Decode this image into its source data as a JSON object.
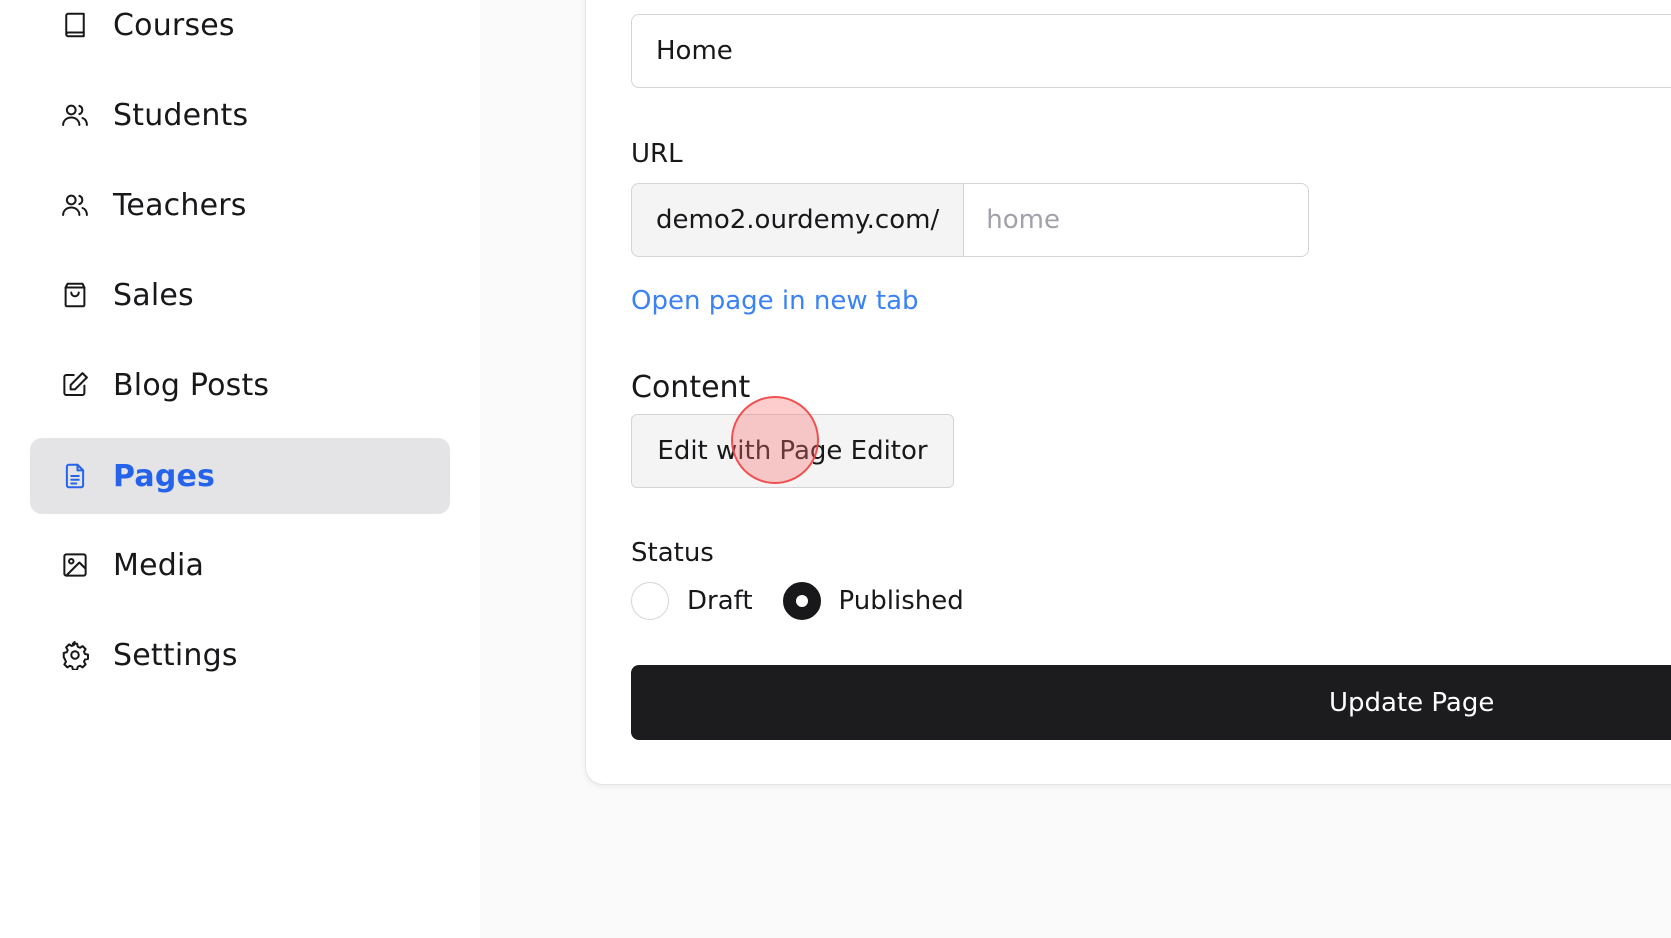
{
  "sidebar": {
    "items": [
      {
        "label": "Courses",
        "icon": "book-icon",
        "active": false
      },
      {
        "label": "Students",
        "icon": "users-icon",
        "active": false
      },
      {
        "label": "Teachers",
        "icon": "users-icon",
        "active": false
      },
      {
        "label": "Sales",
        "icon": "shopping-bag-icon",
        "active": false
      },
      {
        "label": "Blog Posts",
        "icon": "edit-icon",
        "active": false
      },
      {
        "label": "Pages",
        "icon": "document-icon",
        "active": true
      },
      {
        "label": "Media",
        "icon": "image-icon",
        "active": false
      },
      {
        "label": "Settings",
        "icon": "gear-icon",
        "active": false
      }
    ],
    "accent_color": "#2563eb"
  },
  "form": {
    "title_value": "Home",
    "url_label": "URL",
    "url_prefix": "demo2.ourdemy.com/",
    "url_placeholder": "home",
    "open_link_label": "Open page in new tab",
    "content_label": "Content",
    "editor_button_label": "Edit with Page Editor",
    "status_label": "Status",
    "status_options": [
      {
        "label": "Draft",
        "checked": false
      },
      {
        "label": "Published",
        "checked": true
      }
    ],
    "submit_label": "Update Page"
  }
}
